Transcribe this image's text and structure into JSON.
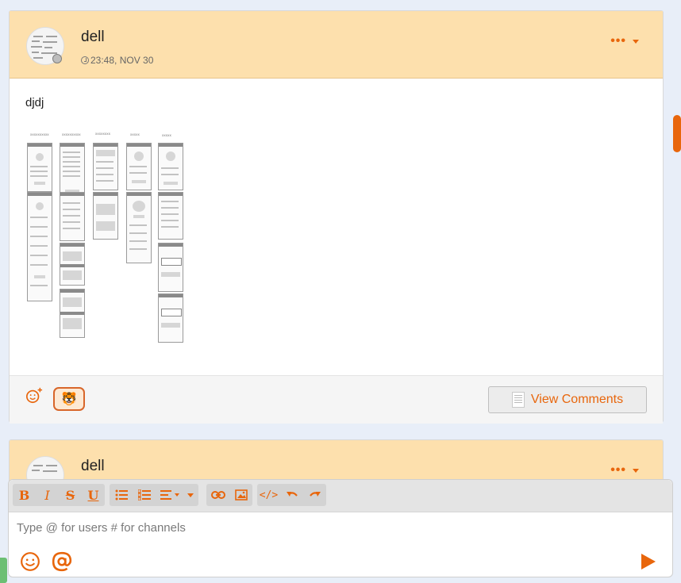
{
  "posts": [
    {
      "author": "dell",
      "timestamp": "23:48, NOV 30",
      "text": "djdj",
      "reaction_emoji": "🐯",
      "view_comments_label": "View Comments"
    },
    {
      "author": "dell"
    }
  ],
  "composer": {
    "placeholder": "Type @ for users # for channels"
  },
  "colors": {
    "accent": "#e8660c",
    "header_bg": "#fde0ad",
    "page_bg": "#e8eef8"
  },
  "icons": {
    "toolbar": [
      "bold-icon",
      "italic-icon",
      "strikethrough-icon",
      "underline-icon",
      "bullet-list-icon",
      "numbered-list-icon",
      "align-icon",
      "link-icon",
      "image-icon",
      "code-icon",
      "undo-icon",
      "redo-icon"
    ],
    "composer": [
      "emoji-icon",
      "mention-icon",
      "send-icon"
    ]
  }
}
